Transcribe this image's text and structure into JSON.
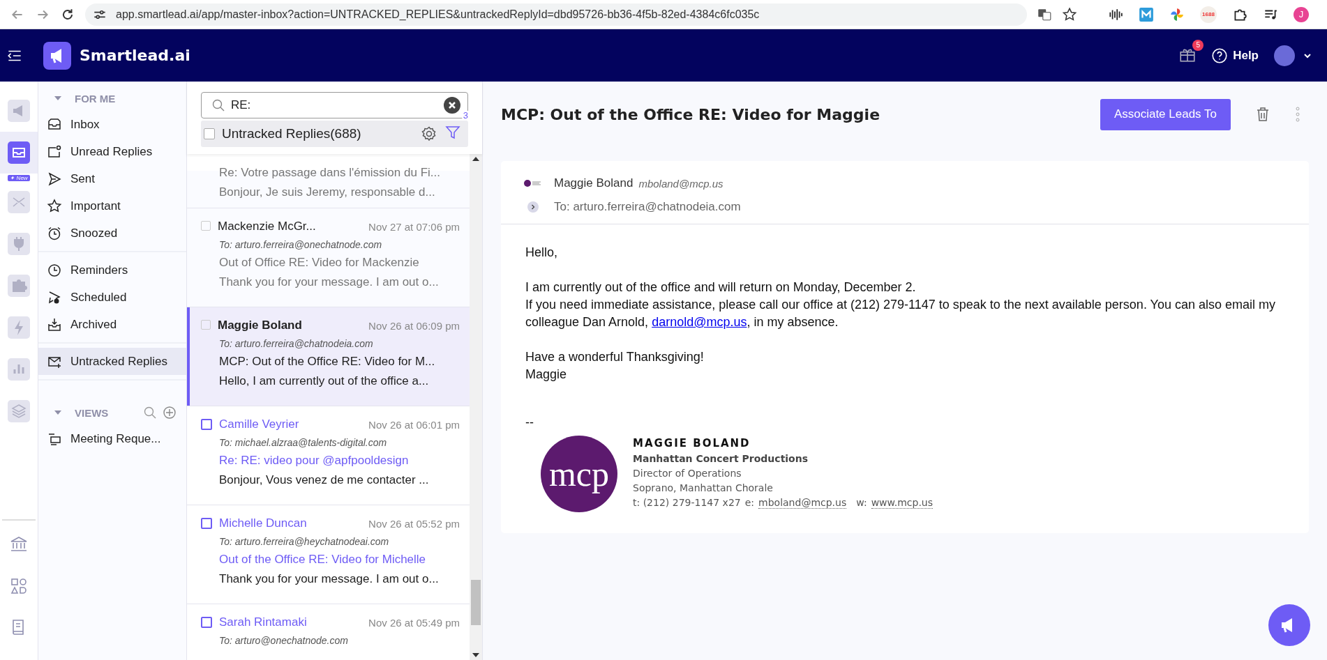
{
  "browser": {
    "url": "app.smartlead.ai/app/master-inbox?action=UNTRACKED_REPLIES&untrackedReplyId=dbd95726-bb36-4f5b-82ed-4384c6fc035c",
    "ext_badge": "1688",
    "profile_initial": "J"
  },
  "app_header": {
    "brand": "Smartlead.ai",
    "gift_count": "5",
    "help": "Help"
  },
  "rail": {
    "new_badge": "✦ New",
    "items": [
      {
        "kind": "megaphone",
        "selected": false
      },
      {
        "kind": "inbox",
        "selected": true
      },
      {
        "kind": "mail-x",
        "selected": false
      },
      {
        "kind": "plug",
        "selected": false
      },
      {
        "kind": "puzzle",
        "selected": false
      },
      {
        "kind": "bolt",
        "selected": false
      },
      {
        "kind": "chart",
        "selected": false
      },
      {
        "kind": "layers",
        "selected": false
      }
    ],
    "bottom_items": [
      {
        "kind": "bank"
      },
      {
        "kind": "shapes"
      },
      {
        "kind": "book"
      }
    ]
  },
  "nav": {
    "section_title": "FOR ME",
    "expanded": true,
    "groups": [
      [
        {
          "label": "Inbox",
          "kind": "inbox",
          "selected": false
        },
        {
          "label": "Unread Replies",
          "kind": "unread",
          "selected": false
        },
        {
          "label": "Sent",
          "kind": "sent",
          "selected": false
        },
        {
          "label": "Important",
          "kind": "star",
          "selected": false
        },
        {
          "label": "Snoozed",
          "kind": "alarm",
          "selected": false
        }
      ],
      [
        {
          "label": "Reminders",
          "kind": "clock",
          "selected": false
        },
        {
          "label": "Scheduled",
          "kind": "scheduled",
          "selected": false
        },
        {
          "label": "Archived",
          "kind": "archive",
          "selected": false
        }
      ],
      [
        {
          "label": "Untracked Replies",
          "kind": "untracked",
          "selected": true
        }
      ]
    ],
    "views_title": "VIEWS",
    "views_expanded": true,
    "views": [
      {
        "label": "Meeting Reque..."
      }
    ]
  },
  "list": {
    "search": {
      "value": "RE:"
    },
    "select_all_checked": false,
    "title": "Untracked Replies(688)",
    "filter_count": "3",
    "items": [
      {
        "subject": "Re: Votre passage dans l'émission du Fi...",
        "preview": "Bonjour, Je suis Jeremy, responsable d...",
        "unread": false,
        "selected": false
      },
      {
        "sender": "Mackenzie McGr...",
        "checked": false,
        "date": "Nov 27 at 07:06 pm",
        "to": "To: arturo.ferreira@onechatnode.com",
        "subject": "Out of Office RE: Video for Mackenzie",
        "preview": "Thank you for your message. I am out o...",
        "unread": false,
        "selected": false
      },
      {
        "sender": "Maggie Boland",
        "checked": false,
        "date": "Nov 26 at 06:09 pm",
        "to": "To: arturo.ferreira@chatnodeia.com",
        "subject": "MCP: Out of the Office RE: Video for M...",
        "preview": "Hello, I am currently out of the office a...",
        "unread": false,
        "selected": true
      },
      {
        "sender": "Camille Veyrier",
        "checked": false,
        "date": "Nov 26 at 06:01 pm",
        "to": "To: michael.alzraa@talents-digital.com",
        "subject": "Re: RE: video pour @apfpooldesign",
        "preview": "Bonjour, Vous venez de me contacter ...",
        "unread": true,
        "selected": false
      },
      {
        "sender": "Michelle Duncan",
        "checked": false,
        "date": "Nov 26 at 05:52 pm",
        "to": "To: arturo.ferreira@heychatnodeai.com",
        "subject": "Out of the Office RE: Video for Michelle",
        "preview": "Thank you for your message. I am out o...",
        "unread": true,
        "selected": false
      },
      {
        "sender": "Sarah Rintamaki",
        "checked": false,
        "date": "Nov 26 at 05:49 pm",
        "to": "To: arturo@onechatnode.com",
        "unread": true,
        "selected": false
      }
    ]
  },
  "message": {
    "subject": "MCP: Out of the Office RE: Video for Maggie",
    "action": "Associate Leads To",
    "sender_name": "Maggie Boland",
    "sender_email": "mboland@mcp.us",
    "to": "To: arturo.ferreira@chatnodeia.com",
    "paragraphs": [
      [
        "Hello,"
      ],
      [
        "I am currently out of the office and will return on Monday, December 2.",
        {
          "before": "If you need immediate assistance, please call our office at (212) 279-1147 to speak to the next available person. You can also email my colleague Dan Arnold, ",
          "link": "darnold@mcp.us",
          "after": ", in my absence."
        }
      ],
      [
        "Have a wonderful Thanksgiving!",
        "Maggie"
      ]
    ],
    "separator": "--",
    "signature": {
      "logo": "mcp",
      "name": "MAGGIE BOLAND",
      "company": "Manhattan Concert Productions",
      "title": "Director of Operations",
      "role": "Soprano, Manhattan Chorale",
      "phone": "t: (212) 279-1147 x27",
      "email_label": "e:",
      "email": "mboland@mcp.us",
      "web_label": "w:",
      "web": "www.mcp.us"
    }
  }
}
